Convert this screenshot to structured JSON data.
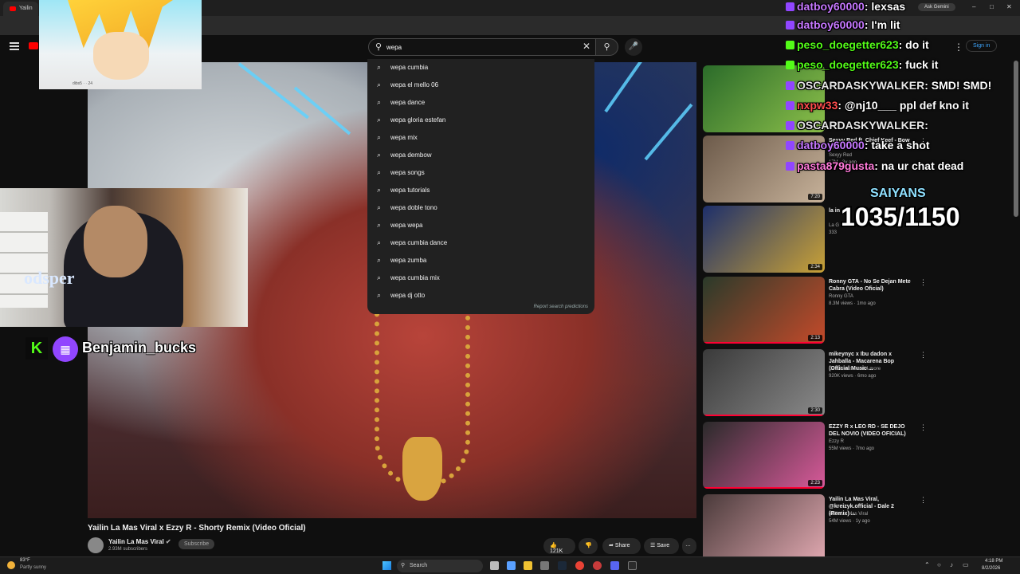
{
  "browser": {
    "tab_label": "Yailin",
    "ask_gemini": "Ask Gemini"
  },
  "header": {
    "search_value": "wepa",
    "search_placeholder": "Search",
    "signin": "Sign in"
  },
  "suggestions": [
    "wepa cumbia",
    "wepa el mello 06",
    "wepa dance",
    "wepa gloria estefan",
    "wepa mix",
    "wepa dembow",
    "wepa songs",
    "wepa tutorials",
    "wepa doble tono",
    "wepa wepa",
    "wepa cumbia dance",
    "wepa zumba",
    "wepa cumbia mix",
    "wepa dj otto"
  ],
  "report_predictions": "Report search predictions",
  "video": {
    "title": "Yailin La Mas Viral x Ezzy R - Shorty Remix (Video Oficial)",
    "channel": "Yailin La Mas Viral",
    "subscribers": "2.93M subscribers",
    "subscribe": "Subscribe",
    "likes": "121K",
    "share": "Share",
    "save": "Save",
    "more": "…"
  },
  "overlay": {
    "streamer": "Benjamin_bucks",
    "kick_letter": "K",
    "emote_caption": "dibs5 · · 24",
    "webcam_shirt": "odsper"
  },
  "recommended": [
    {
      "title": "",
      "channel": "",
      "meta": "",
      "duration": "",
      "progress": 0,
      "colors": [
        "#2b6b2a",
        "#8cc04a"
      ]
    },
    {
      "title": "Sexyy Red ft. Chief Keef - Bow Bow",
      "channel": "Sexyy Red",
      "meta": "17M · 3y ago",
      "duration": "7:20",
      "progress": 0,
      "colors": [
        "#6c5a4a",
        "#c7b29a"
      ]
    },
    {
      "title": "la in",
      "channel": "La G",
      "meta": "333",
      "duration": "2:34",
      "progress": 0,
      "colors": [
        "#1d2f6b",
        "#c9a237"
      ]
    },
    {
      "title": "Ronny GTA - No Se Dejan Mete Cabra (Video Oficial)",
      "channel": "Ronny GTA",
      "meta": "8.3M views · 1mo ago",
      "duration": "2:13",
      "progress": 1,
      "colors": [
        "#2a3a2a",
        "#c44a2a"
      ]
    },
    {
      "title": "mikeynyc x Ibu dadon x Jahballa - Macarena Bop (Official Music ...",
      "channel": "Deevisions · and 4 more",
      "meta": "920K views · 6mo ago",
      "duration": "2:30",
      "progress": 1,
      "colors": [
        "#3a3a3a",
        "#8a8a8a"
      ]
    },
    {
      "title": "EZZY R x LEO RD - SE DEJO DEL NOVIO (VIDEO OFICIAL)",
      "channel": "Ezzy R",
      "meta": "55M views · 7mo ago",
      "duration": "2:23",
      "progress": 1,
      "colors": [
        "#2a2a2a",
        "#d85a9a"
      ]
    },
    {
      "title": "Yailin La Mas Viral, @kreizyk.official - Dale 2 (Remix) ...",
      "channel": "Yailin La Mas Viral",
      "meta": "54M views · 1y ago",
      "duration": "",
      "progress": 0,
      "colors": [
        "#4a3a3a",
        "#e0a8b0"
      ]
    }
  ],
  "chat": [
    {
      "user": "datboy60000",
      "msg": "lexsas",
      "color": "#c678ff",
      "badge": "#9146ff"
    },
    {
      "user": "datboy60000",
      "msg": "I'm lit",
      "color": "#c678ff",
      "badge": "#9146ff"
    },
    {
      "user": "peso_doegetter623",
      "msg": "do it",
      "color": "#53fc18",
      "badge": "#53fc18"
    },
    {
      "user": "peso_doegetter623",
      "msg": "fuck it",
      "color": "#53fc18",
      "badge": "#53fc18"
    },
    {
      "user": "OSCARDASKYWALKER",
      "msg": "SMD! SMD!",
      "color": "#e5e5e5",
      "badge": "#9146ff"
    },
    {
      "user": "nxpw33",
      "msg": "@nj10___ ppl def kno it",
      "color": "#ff4d4d",
      "badge": "#9146ff"
    },
    {
      "user": "OSCARDASKYWALKER",
      "msg": "",
      "color": "#e5e5e5",
      "badge": "#9146ff"
    },
    {
      "user": "datboy60000",
      "msg": "take a shot",
      "color": "#c678ff",
      "badge": "#9146ff"
    },
    {
      "user": "pasta879gusta",
      "msg": "na ur chat dead",
      "color": "#ff7ad9",
      "badge": "#9146ff"
    }
  ],
  "goal": {
    "label": "SAIYANS",
    "current": 1035,
    "target": 1150,
    "text": "1035/1150"
  },
  "taskbar": {
    "temp": "83°F",
    "weather": "Partly sunny",
    "search": "Search",
    "time": "4:18 PM",
    "date": "8/2/2026"
  }
}
